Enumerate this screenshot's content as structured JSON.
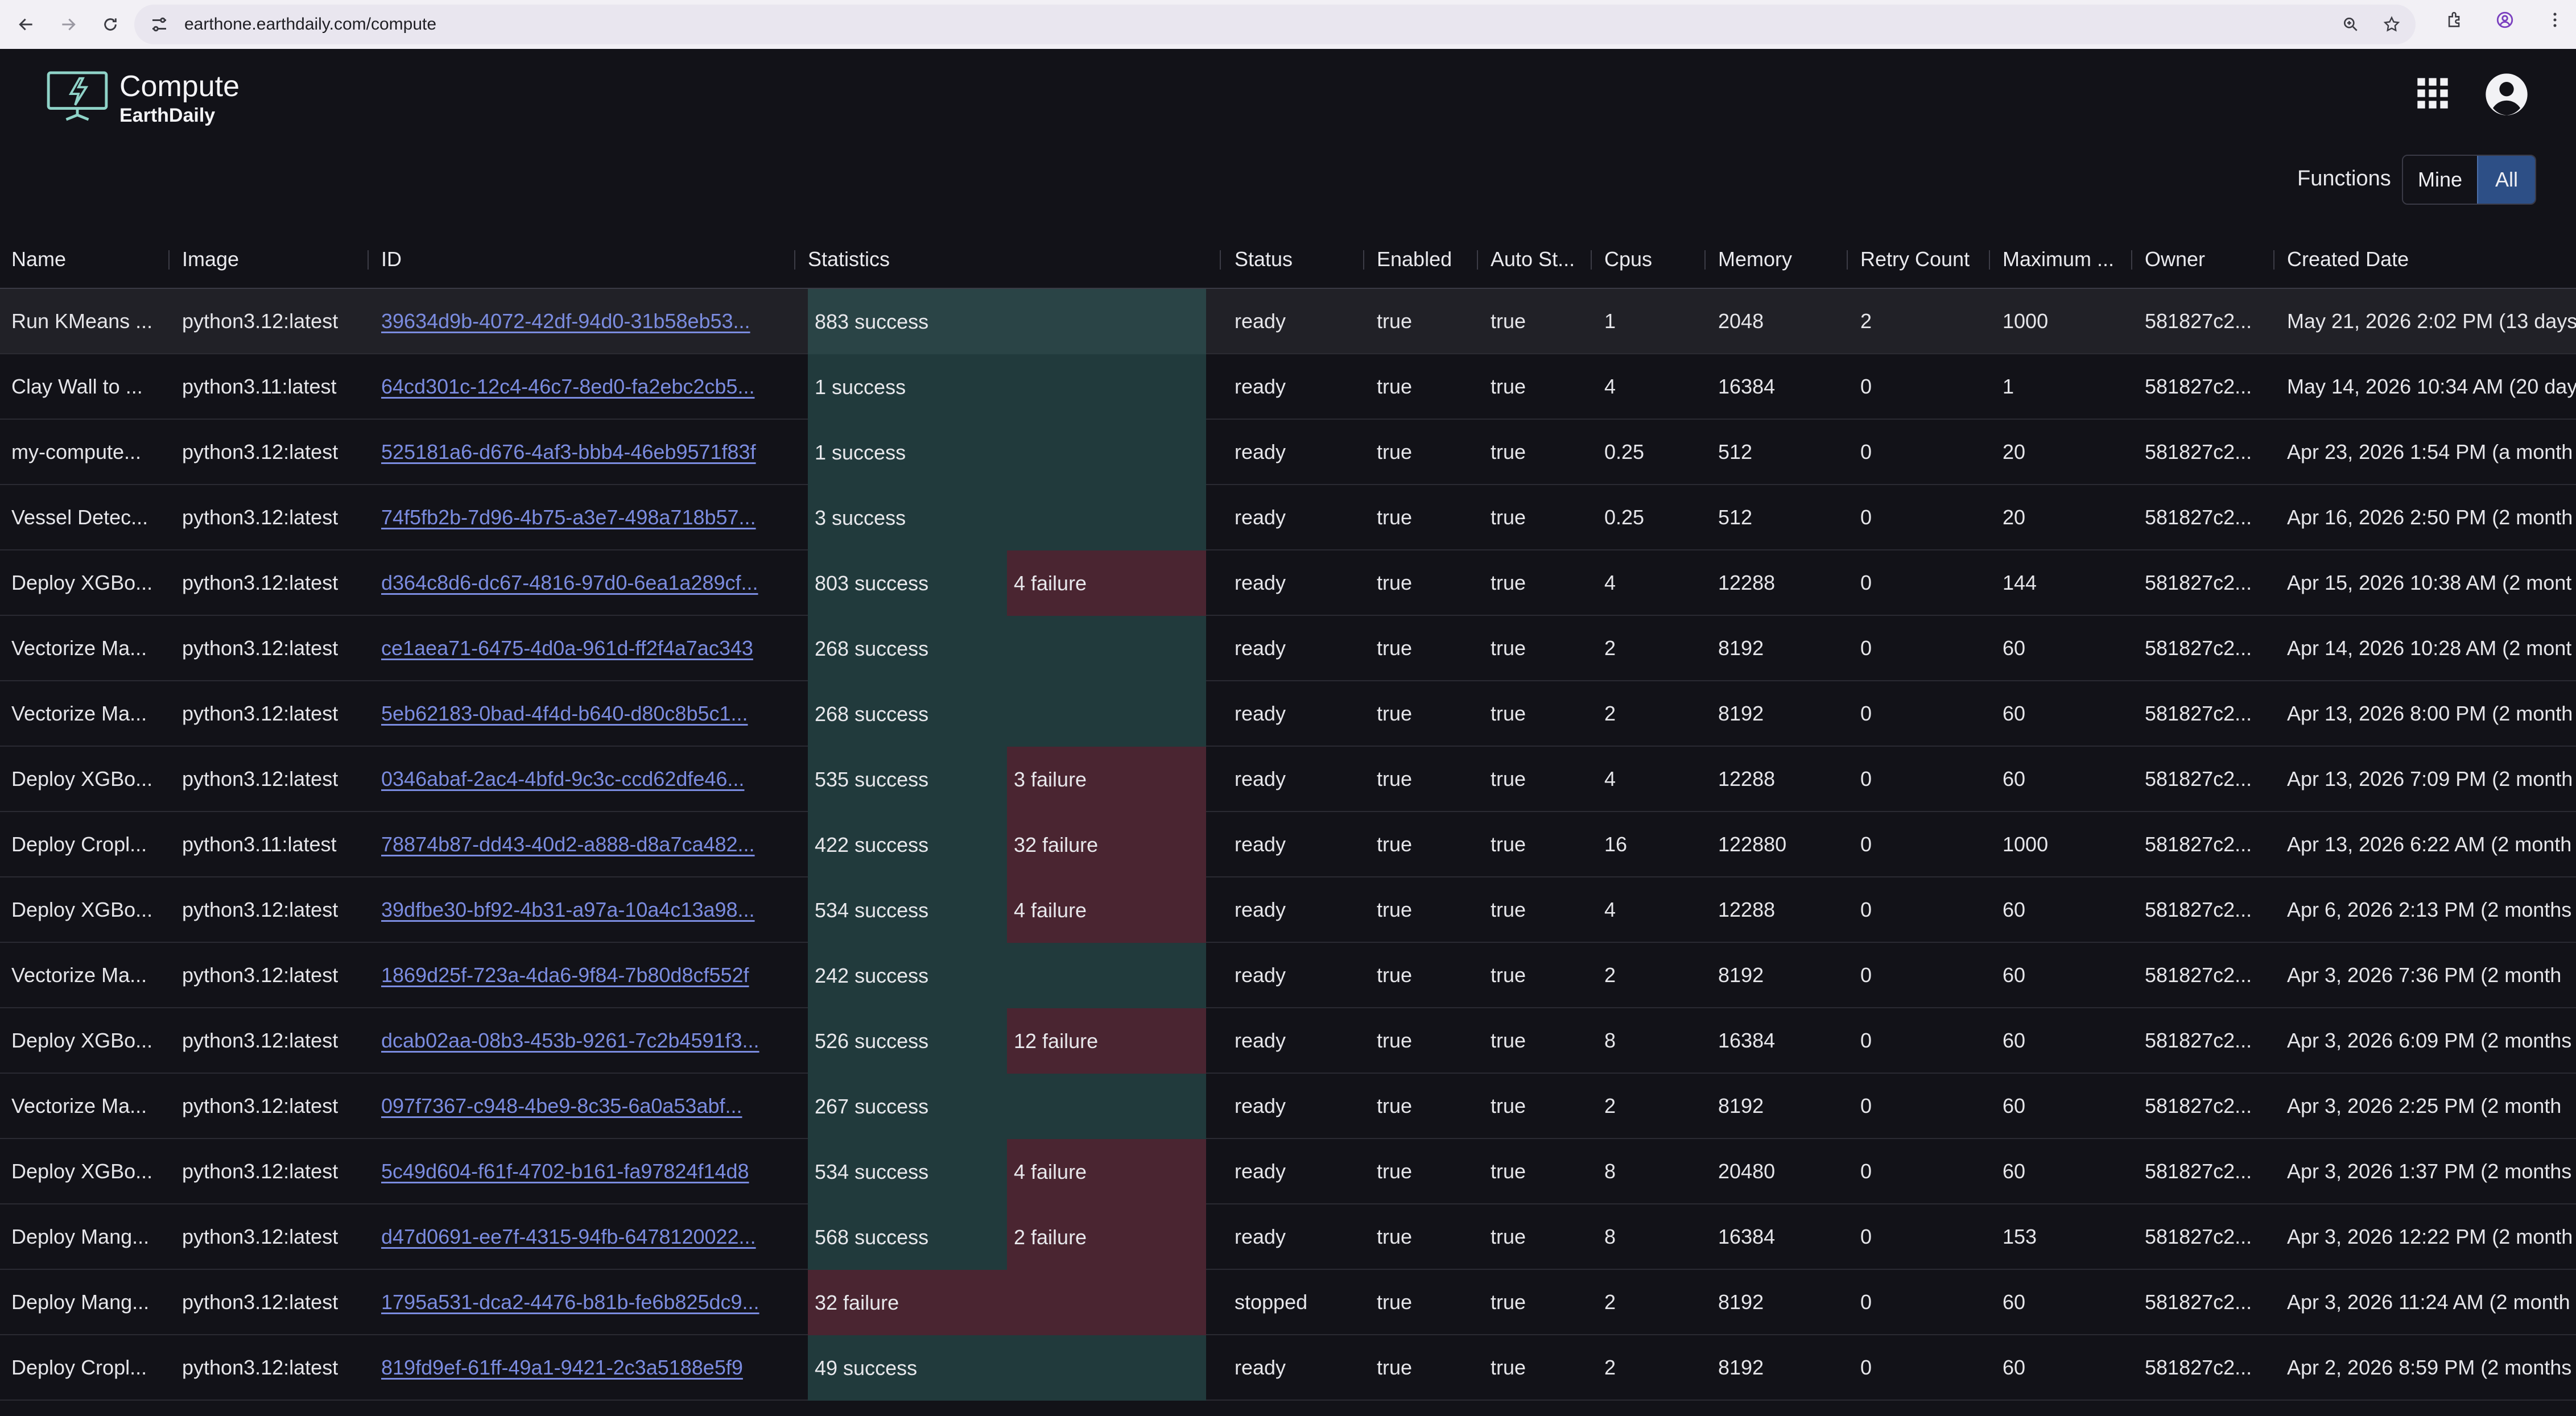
{
  "browser": {
    "url": "earthone.earthdaily.com/compute"
  },
  "app": {
    "title": "Compute",
    "subtitle": "EarthDaily"
  },
  "filter": {
    "label": "Functions",
    "mine_label": "Mine",
    "all_label": "All",
    "active": "All"
  },
  "colors": {
    "success": "#213a3c",
    "failure": "#4a2531",
    "link": "#7b8ce0",
    "toggle_active": "#2d4f86"
  },
  "table": {
    "columns": [
      "Name",
      "Image",
      "ID",
      "Statistics",
      "Status",
      "Enabled",
      "Auto St...",
      "Cpus",
      "Memory",
      "Retry Count",
      "Maximum ...",
      "Owner",
      "Created Date"
    ],
    "rows": [
      {
        "name": "Run KMeans ...",
        "image": "python3.12:latest",
        "id": "39634d9b-4072-42df-94d0-31b58eb53...",
        "success": 883,
        "success_label": "883 success",
        "failure": 0,
        "failure_label": "",
        "status": "ready",
        "enabled": "true",
        "auto_start": "true",
        "cpus": "1",
        "memory": "2048",
        "retry": "2",
        "maximum": "1000",
        "owner": "581827c2...",
        "created": "May 21, 2026 2:02 PM (13 days"
      },
      {
        "name": "Clay Wall to ...",
        "image": "python3.11:latest",
        "id": "64cd301c-12c4-46c7-8ed0-fa2ebc2cb5...",
        "success": 1,
        "success_label": "1 success",
        "failure": 0,
        "failure_label": "",
        "status": "ready",
        "enabled": "true",
        "auto_start": "true",
        "cpus": "4",
        "memory": "16384",
        "retry": "0",
        "maximum": "1",
        "owner": "581827c2...",
        "created": "May 14, 2026 10:34 AM (20 day"
      },
      {
        "name": "my-compute...",
        "image": "python3.12:latest",
        "id": "525181a6-d676-4af3-bbb4-46eb9571f83f",
        "success": 1,
        "success_label": "1 success",
        "failure": 0,
        "failure_label": "",
        "status": "ready",
        "enabled": "true",
        "auto_start": "true",
        "cpus": "0.25",
        "memory": "512",
        "retry": "0",
        "maximum": "20",
        "owner": "581827c2...",
        "created": "Apr 23, 2026 1:54 PM (a month"
      },
      {
        "name": "Vessel Detec...",
        "image": "python3.12:latest",
        "id": "74f5fb2b-7d96-4b75-a3e7-498a718b57...",
        "success": 3,
        "success_label": "3 success",
        "failure": 0,
        "failure_label": "",
        "status": "ready",
        "enabled": "true",
        "auto_start": "true",
        "cpus": "0.25",
        "memory": "512",
        "retry": "0",
        "maximum": "20",
        "owner": "581827c2...",
        "created": "Apr 16, 2026 2:50 PM (2 month"
      },
      {
        "name": "Deploy XGBo...",
        "image": "python3.12:latest",
        "id": "d364c8d6-dc67-4816-97d0-6ea1a289cf...",
        "success": 803,
        "success_label": "803 success",
        "failure": 4,
        "failure_label": "4 failure",
        "status": "ready",
        "enabled": "true",
        "auto_start": "true",
        "cpus": "4",
        "memory": "12288",
        "retry": "0",
        "maximum": "144",
        "owner": "581827c2...",
        "created": "Apr 15, 2026 10:38 AM (2 mont"
      },
      {
        "name": "Vectorize Ma...",
        "image": "python3.12:latest",
        "id": "ce1aea71-6475-4d0a-961d-ff2f4a7ac343",
        "success": 268,
        "success_label": "268 success",
        "failure": 0,
        "failure_label": "",
        "status": "ready",
        "enabled": "true",
        "auto_start": "true",
        "cpus": "2",
        "memory": "8192",
        "retry": "0",
        "maximum": "60",
        "owner": "581827c2...",
        "created": "Apr 14, 2026 10:28 AM (2 mont"
      },
      {
        "name": "Vectorize Ma...",
        "image": "python3.12:latest",
        "id": "5eb62183-0bad-4f4d-b640-d80c8b5c1...",
        "success": 268,
        "success_label": "268 success",
        "failure": 0,
        "failure_label": "",
        "status": "ready",
        "enabled": "true",
        "auto_start": "true",
        "cpus": "2",
        "memory": "8192",
        "retry": "0",
        "maximum": "60",
        "owner": "581827c2...",
        "created": "Apr 13, 2026 8:00 PM (2 month"
      },
      {
        "name": "Deploy XGBo...",
        "image": "python3.12:latest",
        "id": "0346abaf-2ac4-4bfd-9c3c-ccd62dfe46...",
        "success": 535,
        "success_label": "535 success",
        "failure": 3,
        "failure_label": "3 failure",
        "status": "ready",
        "enabled": "true",
        "auto_start": "true",
        "cpus": "4",
        "memory": "12288",
        "retry": "0",
        "maximum": "60",
        "owner": "581827c2...",
        "created": "Apr 13, 2026 7:09 PM (2 month"
      },
      {
        "name": "Deploy Cropl...",
        "image": "python3.11:latest",
        "id": "78874b87-dd43-40d2-a888-d8a7ca482...",
        "success": 422,
        "success_label": "422 success",
        "failure": 32,
        "failure_label": "32 failure",
        "status": "ready",
        "enabled": "true",
        "auto_start": "true",
        "cpus": "16",
        "memory": "122880",
        "retry": "0",
        "maximum": "1000",
        "owner": "581827c2...",
        "created": "Apr 13, 2026 6:22 AM (2 month"
      },
      {
        "name": "Deploy XGBo...",
        "image": "python3.12:latest",
        "id": "39dfbe30-bf92-4b31-a97a-10a4c13a98...",
        "success": 534,
        "success_label": "534 success",
        "failure": 4,
        "failure_label": "4 failure",
        "status": "ready",
        "enabled": "true",
        "auto_start": "true",
        "cpus": "4",
        "memory": "12288",
        "retry": "0",
        "maximum": "60",
        "owner": "581827c2...",
        "created": "Apr 6, 2026 2:13 PM (2 months"
      },
      {
        "name": "Vectorize Ma...",
        "image": "python3.12:latest",
        "id": "1869d25f-723a-4da6-9f84-7b80d8cf552f",
        "success": 242,
        "success_label": "242 success",
        "failure": 0,
        "failure_label": "",
        "status": "ready",
        "enabled": "true",
        "auto_start": "true",
        "cpus": "2",
        "memory": "8192",
        "retry": "0",
        "maximum": "60",
        "owner": "581827c2...",
        "created": "Apr 3, 2026 7:36 PM (2 month"
      },
      {
        "name": "Deploy XGBo...",
        "image": "python3.12:latest",
        "id": "dcab02aa-08b3-453b-9261-7c2b4591f3...",
        "success": 526,
        "success_label": "526 success",
        "failure": 12,
        "failure_label": "12 failure",
        "status": "ready",
        "enabled": "true",
        "auto_start": "true",
        "cpus": "8",
        "memory": "16384",
        "retry": "0",
        "maximum": "60",
        "owner": "581827c2...",
        "created": "Apr 3, 2026 6:09 PM (2 months"
      },
      {
        "name": "Vectorize Ma...",
        "image": "python3.12:latest",
        "id": "097f7367-c948-4be9-8c35-6a0a53abf...",
        "success": 267,
        "success_label": "267 success",
        "failure": 0,
        "failure_label": "",
        "status": "ready",
        "enabled": "true",
        "auto_start": "true",
        "cpus": "2",
        "memory": "8192",
        "retry": "0",
        "maximum": "60",
        "owner": "581827c2...",
        "created": "Apr 3, 2026 2:25 PM (2 month"
      },
      {
        "name": "Deploy XGBo...",
        "image": "python3.12:latest",
        "id": "5c49d604-f61f-4702-b161-fa97824f14d8",
        "success": 534,
        "success_label": "534 success",
        "failure": 4,
        "failure_label": "4 failure",
        "status": "ready",
        "enabled": "true",
        "auto_start": "true",
        "cpus": "8",
        "memory": "20480",
        "retry": "0",
        "maximum": "60",
        "owner": "581827c2...",
        "created": "Apr 3, 2026 1:37 PM (2 months"
      },
      {
        "name": "Deploy Mang...",
        "image": "python3.12:latest",
        "id": "d47d0691-ee7f-4315-94fb-6478120022...",
        "success": 568,
        "success_label": "568 success",
        "failure": 2,
        "failure_label": "2 failure",
        "status": "ready",
        "enabled": "true",
        "auto_start": "true",
        "cpus": "8",
        "memory": "16384",
        "retry": "0",
        "maximum": "153",
        "owner": "581827c2...",
        "created": "Apr 3, 2026 12:22 PM (2 month"
      },
      {
        "name": "Deploy Mang...",
        "image": "python3.12:latest",
        "id": "1795a531-dca2-4476-b81b-fe6b825dc9...",
        "success": 0,
        "success_label": "",
        "failure": 32,
        "failure_label": "32 failure",
        "status": "stopped",
        "enabled": "true",
        "auto_start": "true",
        "cpus": "2",
        "memory": "8192",
        "retry": "0",
        "maximum": "60",
        "owner": "581827c2...",
        "created": "Apr 3, 2026 11:24 AM (2 month"
      },
      {
        "name": "Deploy Cropl...",
        "image": "python3.12:latest",
        "id": "819fd9ef-61ff-49a1-9421-2c3a5188e5f9",
        "success": 49,
        "success_label": "49 success",
        "failure": 0,
        "failure_label": "",
        "status": "ready",
        "enabled": "true",
        "auto_start": "true",
        "cpus": "2",
        "memory": "8192",
        "retry": "0",
        "maximum": "60",
        "owner": "581827c2...",
        "created": "Apr 2, 2026 8:59 PM (2 months"
      }
    ]
  }
}
